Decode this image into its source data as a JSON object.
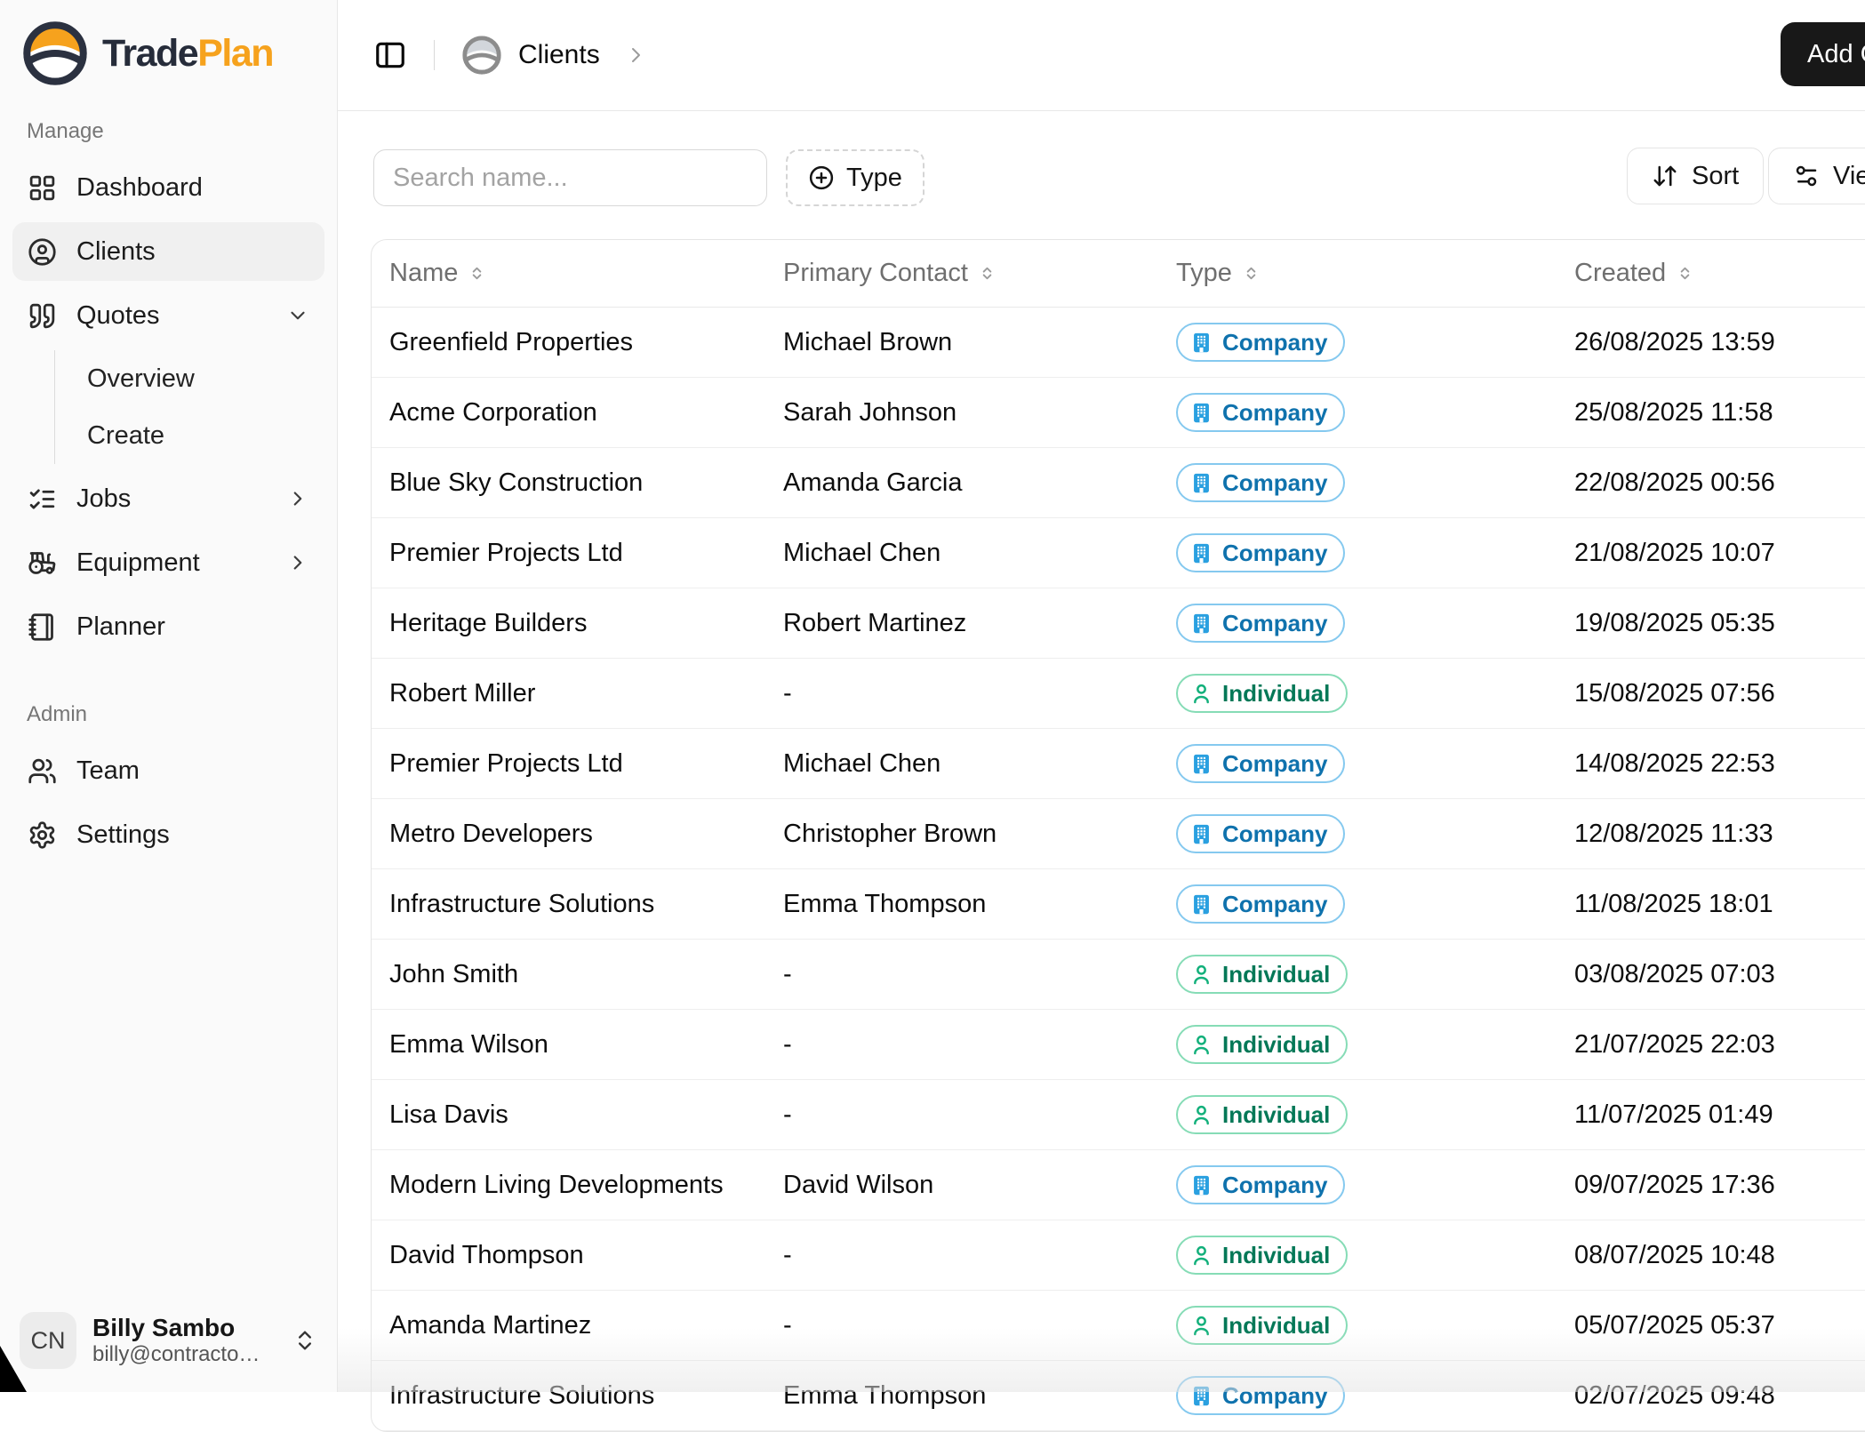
{
  "brand": {
    "name_primary": "Trade",
    "name_secondary": "Plan",
    "accent_color": "#f6a21d",
    "dark_color": "#262c3a"
  },
  "sidebar": {
    "sections": [
      {
        "label": "Manage"
      },
      {
        "label": "Admin"
      }
    ],
    "items": {
      "dashboard": "Dashboard",
      "clients": "Clients",
      "quotes": "Quotes",
      "overview": "Overview",
      "create": "Create",
      "jobs": "Jobs",
      "equipment": "Equipment",
      "planner": "Planner",
      "team": "Team",
      "settings": "Settings"
    },
    "user": {
      "initials": "CN",
      "name": "Billy Sambo",
      "email": "billy@contracto…"
    }
  },
  "header": {
    "breadcrumb": "Clients",
    "add_button": "Add Client"
  },
  "toolbar": {
    "search_placeholder": "Search name...",
    "type_label": "Type",
    "sort_label": "Sort",
    "view_label": "View"
  },
  "table": {
    "columns": [
      "Name",
      "Primary Contact",
      "Type",
      "Created"
    ],
    "empty_value": "-",
    "badge_colors": {
      "company": {
        "border": "#85c9ef",
        "text": "#0f72ad",
        "icon": "#2aa0e0"
      },
      "individual": {
        "border": "#86dcb6",
        "text": "#047857",
        "icon": "#13b07b"
      }
    },
    "rows": [
      {
        "name": "Greenfield Properties",
        "contact": "Michael Brown",
        "type": "Company",
        "created": "26/08/2025 13:59"
      },
      {
        "name": "Acme Corporation",
        "contact": "Sarah Johnson",
        "type": "Company",
        "created": "25/08/2025 11:58"
      },
      {
        "name": "Blue Sky Construction",
        "contact": "Amanda Garcia",
        "type": "Company",
        "created": "22/08/2025 00:56"
      },
      {
        "name": "Premier Projects Ltd",
        "contact": "Michael Chen",
        "type": "Company",
        "created": "21/08/2025 10:07"
      },
      {
        "name": "Heritage Builders",
        "contact": "Robert Martinez",
        "type": "Company",
        "created": "19/08/2025 05:35"
      },
      {
        "name": "Robert Miller",
        "contact": "-",
        "type": "Individual",
        "created": "15/08/2025 07:56"
      },
      {
        "name": "Premier Projects Ltd",
        "contact": "Michael Chen",
        "type": "Company",
        "created": "14/08/2025 22:53"
      },
      {
        "name": "Metro Developers",
        "contact": "Christopher Brown",
        "type": "Company",
        "created": "12/08/2025 11:33"
      },
      {
        "name": "Infrastructure Solutions",
        "contact": "Emma Thompson",
        "type": "Company",
        "created": "11/08/2025 18:01"
      },
      {
        "name": "John Smith",
        "contact": "-",
        "type": "Individual",
        "created": "03/08/2025 07:03"
      },
      {
        "name": "Emma Wilson",
        "contact": "-",
        "type": "Individual",
        "created": "21/07/2025 22:03"
      },
      {
        "name": "Lisa Davis",
        "contact": "-",
        "type": "Individual",
        "created": "11/07/2025 01:49"
      },
      {
        "name": "Modern Living Developments",
        "contact": "David Wilson",
        "type": "Company",
        "created": "09/07/2025 17:36"
      },
      {
        "name": "David Thompson",
        "contact": "-",
        "type": "Individual",
        "created": "08/07/2025 10:48"
      },
      {
        "name": "Amanda Martinez",
        "contact": "-",
        "type": "Individual",
        "created": "05/07/2025 05:37"
      },
      {
        "name": "Infrastructure Solutions",
        "contact": "Emma Thompson",
        "type": "Company",
        "created": "02/07/2025 09:48"
      }
    ]
  }
}
